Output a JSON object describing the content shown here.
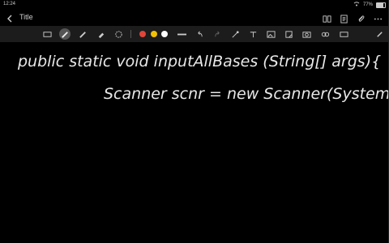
{
  "status": {
    "time": "12:24",
    "wifi": "wifi-icon",
    "battery_percent": "77%",
    "battery_level": 0.77
  },
  "header": {
    "title": "Title"
  },
  "toolbar": {
    "colors": [
      "#e0453a",
      "#f2c100",
      "#ffffff"
    ],
    "icons": [
      "keyboard-icon",
      "pen-icon",
      "highlighter-icon",
      "eraser-icon",
      "lasso-icon",
      "color-red",
      "color-yellow",
      "color-white",
      "line-width-icon",
      "undo-icon",
      "redo-icon",
      "shapes-icon",
      "text-icon",
      "image-icon",
      "sticker-icon",
      "camera-icon",
      "more-icon"
    ]
  },
  "canvas": {
    "line1": "public static void inputAllBases (String[] args){",
    "line2": "Scanner scnr = new Scanner(System.in);"
  }
}
